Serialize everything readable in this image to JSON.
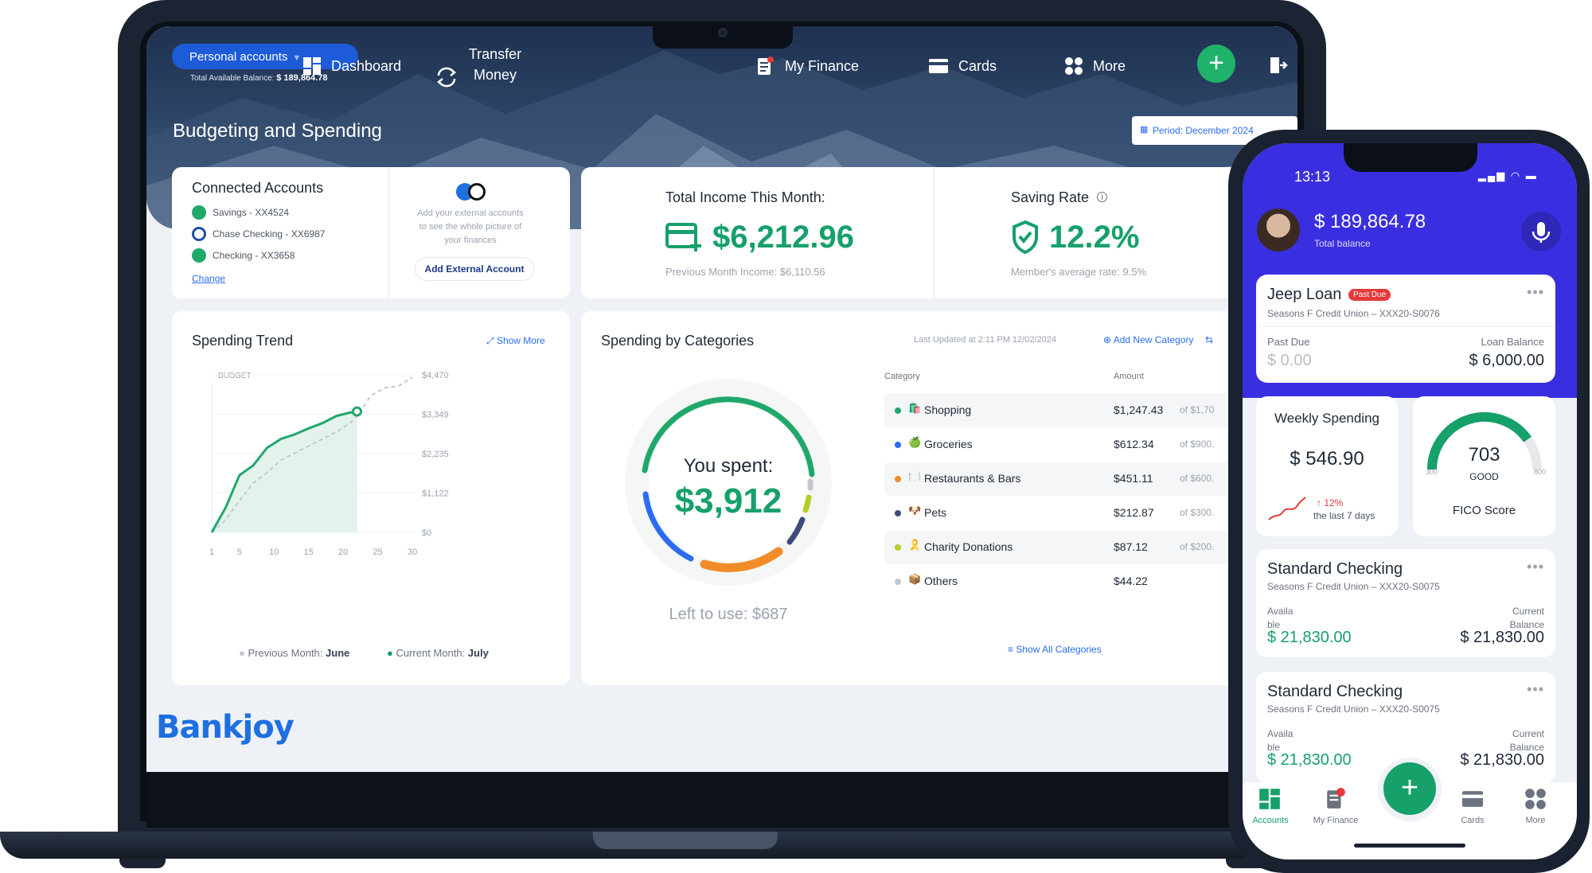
{
  "laptop": {
    "nav": {
      "account_selector": "Personal accounts",
      "balance_label": "Total Available Balance:",
      "balance_value": "$ 189,864.78",
      "dashboard": "Dashboard",
      "transfer_line1": "Transfer",
      "transfer_line2": "Money",
      "my_finance": "My Finance",
      "cards": "Cards",
      "more": "More",
      "plus": "+"
    },
    "page_title": "Budgeting and Spending",
    "period": "Period: December 2024",
    "connected_accounts": {
      "title": "Connected Accounts",
      "accounts": [
        "Savings - XX4524",
        "Chase Checking - XX6987",
        "Checking - XX3658"
      ],
      "change": "Change",
      "ext_text_1": "Add your external accounts",
      "ext_text_2": "to see the whole picture of",
      "ext_text_3": "your finances",
      "add_external": "Add External Account"
    },
    "income": {
      "title": "Total Income This Month:",
      "value": "$6,212.96",
      "previous": "Previous Month Income: $6,110.56"
    },
    "saving": {
      "title": "Saving Rate",
      "value": "12.2%",
      "members": "Member's average rate: 9.5%"
    },
    "trend": {
      "title": "Spending Trend",
      "show_more": "Show More",
      "budget_label": "BUDGET",
      "y_ticks": [
        "$4,470",
        "$3,349",
        "$2,235",
        "$1,122",
        "$0"
      ],
      "x_ticks": [
        "1",
        "5",
        "10",
        "15",
        "20",
        "25",
        "30"
      ],
      "legend_prev_label": "Previous Month:",
      "legend_prev_value": "June",
      "legend_cur_label": "Current Month:",
      "legend_cur_value": "July"
    },
    "categories": {
      "title": "Spending by Categories",
      "updated": "Last Updated at 2:11 PM 12/02/2024",
      "add_new": "Add New Category",
      "col_category": "Category",
      "col_amount": "Amount",
      "you_spent_label": "You spent:",
      "you_spent_value": "$3,912",
      "left_to_use": "Left to use: $687",
      "show_all": "Show All Categories",
      "rows": [
        {
          "name": "Shopping",
          "emoji": "🛍️",
          "amount": "$1,247.43",
          "of": "of $1,70",
          "color": "#20a86b"
        },
        {
          "name": "Groceries",
          "emoji": "🍏",
          "amount": "$612.34",
          "of": "of $900.",
          "color": "#2b6cf0"
        },
        {
          "name": "Restaurants & Bars",
          "emoji": "🍽️",
          "amount": "$451.11",
          "of": "of $600.",
          "color": "#f28c28"
        },
        {
          "name": "Pets",
          "emoji": "🐶",
          "amount": "$212.87",
          "of": "of $300.",
          "color": "#3d4a7a"
        },
        {
          "name": "Charity Donations",
          "emoji": "🎗️",
          "amount": "$87.12",
          "of": "of $200.",
          "color": "#b5cc2a"
        },
        {
          "name": "Others",
          "emoji": "📦",
          "amount": "$44.22",
          "of": "",
          "color": "#c4c8ce"
        }
      ]
    },
    "brand": "Bankjoy"
  },
  "chart_data": {
    "type": "line",
    "x": [
      1,
      3,
      5,
      7,
      9,
      11,
      13,
      15,
      17,
      19,
      21,
      22,
      24,
      26,
      28,
      30
    ],
    "series": [
      {
        "name": "Current Month: July",
        "values": [
          0,
          700,
          1620,
          1900,
          2400,
          2650,
          2780,
          2950,
          3100,
          3300,
          3400,
          3430
        ]
      },
      {
        "name": "Previous Month: June",
        "values": [
          0,
          350,
          900,
          1400,
          1700,
          2050,
          2250,
          2450,
          2650,
          2850,
          3100,
          3300,
          3880,
          4100,
          4150,
          4400
        ]
      }
    ],
    "ylim": [
      0,
      4470
    ],
    "xlim": [
      1,
      30
    ]
  },
  "phone": {
    "time": "13:13",
    "balance": "$ 189,864.78",
    "balance_label": "Total balance",
    "loan": {
      "title": "Jeep Loan",
      "badge": "Past Due",
      "sub": "Seasons F Credit Union – XXX20-S0076",
      "past_due_label": "Past Due",
      "past_due_value": "$ 0.00",
      "loan_balance_label": "Loan Balance",
      "loan_balance_value": "$ 6,000.00"
    },
    "weekly": {
      "title": "Weekly Spending",
      "value": "$ 546.90",
      "change": "↑ 12%",
      "period": "the last 7 days"
    },
    "fico": {
      "score": "703",
      "rating": "GOOD",
      "min": "300",
      "max": "800",
      "label": "FICO Score",
      "value": 0.806
    },
    "checking_1": {
      "title": "Standard Checking",
      "sub": "Seasons F Credit Union – XXX20-S0075",
      "avail_label_1": "Availa",
      "avail_label_2": "ble",
      "avail_value": "$ 21,830.00",
      "current_label_1": "Current",
      "current_label_2": "Balance",
      "current_value": "$ 21,830.00"
    },
    "checking_2": {
      "title": "Standard Checking",
      "sub": "Seasons F Credit Union – XXX20-S0075",
      "avail_label_1": "Availa",
      "avail_label_2": "ble",
      "avail_value": "$ 21,830.00",
      "current_label_1": "Current",
      "current_label_2": "Balance",
      "current_value": "$ 21,830.00"
    },
    "tabs": [
      "Accounts",
      "My Finance",
      "Cards",
      "More"
    ],
    "fab": "+"
  },
  "colors": {
    "brand_green": "#16a06a",
    "brand_blue": "#2b6cf0",
    "phone_header": "#3a2fe0"
  }
}
